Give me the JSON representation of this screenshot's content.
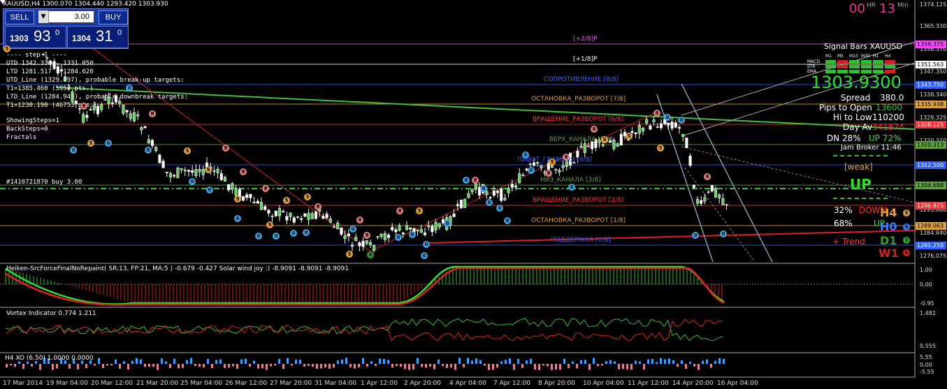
{
  "window_title": "XAUUSD,H4  1300.070 1304.440 1293.420 1303.930",
  "trade_panel": {
    "sell_label": "SELL",
    "buy_label": "BUY",
    "lot": "3.00",
    "bid_small": "1303",
    "bid_big": "93",
    "bid_sup": "0",
    "ask_small": "1304",
    "ask_big": "31",
    "ask_sup": "0"
  },
  "timer": {
    "hours": "00",
    "hr_label": "HR",
    "minutes": "13",
    "min_label": "Min"
  },
  "info_lines": [
    "---- step 1 ----",
    "UTD 1342.330 - 1331.050",
    "LTD 1281.517 - 1284.620",
    "UTD_Line (1329.897), probable break-up targets:",
    "T1=1385.460 (5957 pts.)",
    "LTD_Line (1284.943), probable downbreak targets:",
    "T1=1230.190 (46753 pts.)",
    "ShowingSteps=1",
    "BackSteps=0",
    "Fractals"
  ],
  "order_label": "#1410721870 buy 3.00",
  "levels": [
    {
      "label": "[+2/8]P",
      "color": "#ff44ff"
    },
    {
      "label": "[+1/8]P",
      "color": "#ffffff"
    },
    {
      "label": "СОПРОТИВЛЕНИЕ [8/8]",
      "color": "#3060ff"
    },
    {
      "label": "ОСТАНОВКА_РАЗВОРОТ [7/8]",
      "color": "#e0a040"
    },
    {
      "label": "ВРАЩЕНИЕ_РАЗВОРОТ [6/8]",
      "color": "#ff3030"
    },
    {
      "label": "ВЕРХ_КАНАЛА [5/8]",
      "color": "#60a040"
    },
    {
      "label": "ПИВОТ_ГЛАВНЫЙ [4/8]",
      "color": "#3060ff"
    },
    {
      "label": "НИЗ_КАНАЛА [3/8]",
      "color": "#60a040"
    },
    {
      "label": "ВРАЩЕНИЕ_РАЗВОРОТ [2/8]",
      "color": "#ff3030"
    },
    {
      "label": "ОСТАНОВКА_РАЗВОРОТ [1/8]",
      "color": "#e0a040"
    },
    {
      "label": "ПОДДЕРЖКА [0/8]",
      "color": "#3060ff"
    }
  ],
  "price_tags": [
    {
      "value": "1359.375",
      "color": "#ff44ff"
    },
    {
      "value": "1351.563",
      "color": "#ffffff"
    },
    {
      "value": "1343.750",
      "color": "#3060ff"
    },
    {
      "value": "1335.938",
      "color": "#e0a040"
    },
    {
      "value": "1328.125",
      "color": "#ff3030"
    },
    {
      "value": "1320.313",
      "color": "#60a040"
    },
    {
      "value": "1312.500",
      "color": "#3060ff"
    },
    {
      "value": "1304.688",
      "color": "#60a040"
    },
    {
      "value": "1296.875",
      "color": "#ff3030"
    },
    {
      "value": "1289.063",
      "color": "#e0a040"
    },
    {
      "value": "1281.250",
      "color": "#3060ff"
    }
  ],
  "axis_prices": [
    "1374.125",
    "1365.330",
    "1356.370",
    "1347.350",
    "1338.340",
    "1329.325",
    "1320.310",
    "1311.295",
    "1302.280",
    "1293.860",
    "1284.840",
    "1276.075"
  ],
  "subwindow_axes": {
    "solar": [
      "1.00",
      "0.00",
      "-0.95"
    ],
    "vortex": [
      "1.482",
      "0.555"
    ],
    "xo": [
      "5.55",
      "0.00",
      "-5.55"
    ]
  },
  "dates": [
    "17 Mar 2014",
    "19 Mar 04:00",
    "20 Mar 12:00",
    "21 Mar 20:00",
    "25 Mar 04:00",
    "26 Mar 12:00",
    "27 Mar 20:00",
    "31 Mar 04:00",
    "1 Apr 12:00",
    "2 Apr 20:00",
    "4 Apr 04:00",
    "7 Apr 12:00",
    "8 Apr 20:00",
    "10 Apr 04:00",
    "11 Apr 12:00",
    "14 Apr 20:00",
    "16 Apr 04:00"
  ],
  "signal_panel": {
    "title": "Signal Bars XAUUSD",
    "timeframes": [
      "M1",
      "M5",
      "M15",
      "M30",
      "H1",
      "H4"
    ],
    "rows": [
      "MACD",
      "STR",
      "EMA"
    ],
    "price": "1303.9300",
    "spread_label": "Spread",
    "spread_value": "380.0",
    "pips_label": "Pips to Open",
    "pips_value": "13600",
    "hilow_label": "Hi to Low",
    "hilow_value": "110200",
    "dayav_label": "Day Av",
    "dayav_value": "341874",
    "dn_label": "DN 28%",
    "up_label": "UP 72%",
    "broker_time": "Jam Broker 11:46",
    "weak_label": "[weak]",
    "direction": "UP",
    "pct32": "32%",
    "down_label": "DOWN",
    "pct68": "68%",
    "up_small": "UP",
    "trend_label": "+ Trend",
    "tf_h4": "H4",
    "tf_h0": "H0",
    "tf_d1": "D1",
    "tf_w1": "W1"
  },
  "indicators": {
    "solar": "Heiken-SrcForceFinalNoRepaint( SR:13, FP:21, MA:5 ) -0.679 -0.427  Solar wind joy :) -8.9091 -8.9091 -8.9091",
    "vortex": "Vortex Indicator 0.774 1.211",
    "xo": "H4 XO (6.50) 1.0000 0.0000"
  }
}
